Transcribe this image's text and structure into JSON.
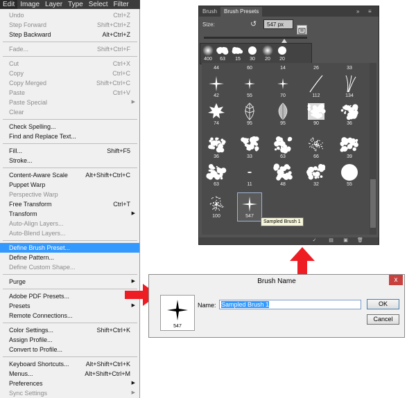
{
  "menubar": {
    "items": [
      "Edit",
      "Image",
      "Layer",
      "Type",
      "Select",
      "Filter"
    ]
  },
  "edit_menu": {
    "items": [
      {
        "label": "Undo",
        "shortcut": "Ctrl+Z",
        "disabled": true
      },
      {
        "label": "Step Forward",
        "shortcut": "Shift+Ctrl+Z",
        "disabled": true
      },
      {
        "label": "Step Backward",
        "shortcut": "Alt+Ctrl+Z",
        "disabled": false
      },
      {
        "label": "Fade...",
        "shortcut": "Shift+Ctrl+F",
        "disabled": true
      },
      {
        "label": "Cut",
        "shortcut": "Ctrl+X",
        "disabled": true
      },
      {
        "label": "Copy",
        "shortcut": "Ctrl+C",
        "disabled": true
      },
      {
        "label": "Copy Merged",
        "shortcut": "Shift+Ctrl+C",
        "disabled": true
      },
      {
        "label": "Paste",
        "shortcut": "Ctrl+V",
        "disabled": true
      },
      {
        "label": "Paste Special",
        "shortcut": "",
        "disabled": true
      },
      {
        "label": "Clear",
        "shortcut": "",
        "disabled": true
      },
      {
        "label": "Check Spelling...",
        "shortcut": "",
        "disabled": false
      },
      {
        "label": "Find and Replace Text...",
        "shortcut": "",
        "disabled": false
      },
      {
        "label": "Fill...",
        "shortcut": "Shift+F5",
        "disabled": false
      },
      {
        "label": "Stroke...",
        "shortcut": "",
        "disabled": false
      },
      {
        "label": "Content-Aware Scale",
        "shortcut": "Alt+Shift+Ctrl+C",
        "disabled": false
      },
      {
        "label": "Puppet Warp",
        "shortcut": "",
        "disabled": false
      },
      {
        "label": "Perspective Warp",
        "shortcut": "",
        "disabled": true
      },
      {
        "label": "Free Transform",
        "shortcut": "Ctrl+T",
        "disabled": false
      },
      {
        "label": "Transform",
        "shortcut": "",
        "disabled": false
      },
      {
        "label": "Auto-Align Layers...",
        "shortcut": "",
        "disabled": true
      },
      {
        "label": "Auto-Blend Layers...",
        "shortcut": "",
        "disabled": true
      },
      {
        "label": "Define Brush Preset...",
        "shortcut": "",
        "disabled": false,
        "highlighted": true
      },
      {
        "label": "Define Pattern...",
        "shortcut": "",
        "disabled": false
      },
      {
        "label": "Define Custom Shape...",
        "shortcut": "",
        "disabled": true
      },
      {
        "label": "Purge",
        "shortcut": "",
        "disabled": false
      },
      {
        "label": "Adobe PDF Presets...",
        "shortcut": "",
        "disabled": false
      },
      {
        "label": "Presets",
        "shortcut": "",
        "disabled": false
      },
      {
        "label": "Remote Connections...",
        "shortcut": "",
        "disabled": false
      },
      {
        "label": "Color Settings...",
        "shortcut": "Shift+Ctrl+K",
        "disabled": false
      },
      {
        "label": "Assign Profile...",
        "shortcut": "",
        "disabled": false
      },
      {
        "label": "Convert to Profile...",
        "shortcut": "",
        "disabled": false
      },
      {
        "label": "Keyboard Shortcuts...",
        "shortcut": "Alt+Shift+Ctrl+K",
        "disabled": false
      },
      {
        "label": "Menus...",
        "shortcut": "Alt+Shift+Ctrl+M",
        "disabled": false
      },
      {
        "label": "Preferences",
        "shortcut": "",
        "disabled": false
      },
      {
        "label": "Sync Settings",
        "shortcut": "",
        "disabled": true
      }
    ]
  },
  "brush_panel": {
    "tabs": [
      "Brush",
      "Brush Presets"
    ],
    "size_label": "Size:",
    "size_value": "547 px",
    "size_slider_fraction": 0.78,
    "recent_sizes": [
      "400",
      "63",
      "15",
      "30",
      "20",
      "20"
    ],
    "rows": [
      [
        "44",
        "60",
        "14",
        "26",
        "33"
      ],
      [
        "42",
        "55",
        "70",
        "112",
        "134"
      ],
      [
        "74",
        "95",
        "95",
        "90",
        "36"
      ],
      [
        "36",
        "33",
        "63",
        "66",
        "39"
      ],
      [
        "63",
        "11",
        "48",
        "32",
        "55"
      ],
      [
        "100",
        "547"
      ]
    ],
    "selected_brush_tooltip": "Sampled Brush 1"
  },
  "dialog": {
    "title": "Brush Name",
    "close": "x",
    "thumb_size": "547",
    "name_label": "Name:",
    "name_value": "Sampled Brush 1",
    "ok_label": "OK",
    "cancel_label": "Cancel"
  },
  "colors": {
    "arrow": "#ee1d24",
    "highlight": "#3399ff",
    "panel_bg": "#535353"
  }
}
